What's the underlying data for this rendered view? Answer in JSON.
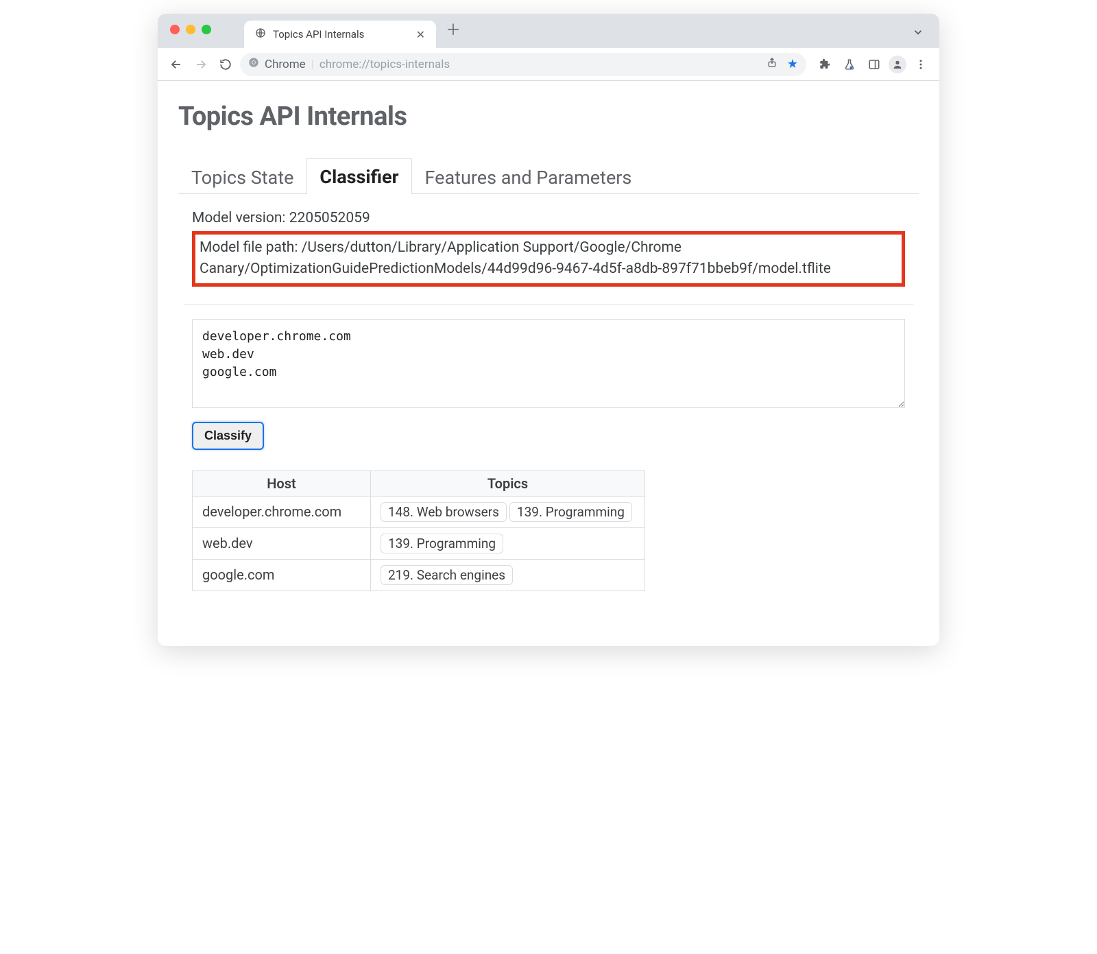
{
  "window": {
    "tab_title": "Topics API Internals"
  },
  "omnibox": {
    "scheme_label": "Chrome",
    "url": "chrome://topics-internals"
  },
  "page": {
    "title": "Topics API Internals",
    "tabs": [
      {
        "label": "Topics State",
        "active": false
      },
      {
        "label": "Classifier",
        "active": true
      },
      {
        "label": "Features and Parameters",
        "active": false
      }
    ],
    "model_version_label": "Model version:",
    "model_version": "2205052059",
    "model_path_label": "Model file path:",
    "model_path": "/Users/dutton/Library/Application Support/Google/Chrome Canary/OptimizationGuidePredictionModels/44d99d96-9467-4d5f-a8db-897f71bbeb9f/model.tflite",
    "hosts_textarea": "developer.chrome.com\nweb.dev\ngoogle.com",
    "classify_label": "Classify",
    "table": {
      "headers": [
        "Host",
        "Topics"
      ],
      "rows": [
        {
          "host": "developer.chrome.com",
          "topics": [
            "148. Web browsers",
            "139. Programming"
          ]
        },
        {
          "host": "web.dev",
          "topics": [
            "139. Programming"
          ]
        },
        {
          "host": "google.com",
          "topics": [
            "219. Search engines"
          ]
        }
      ]
    }
  }
}
